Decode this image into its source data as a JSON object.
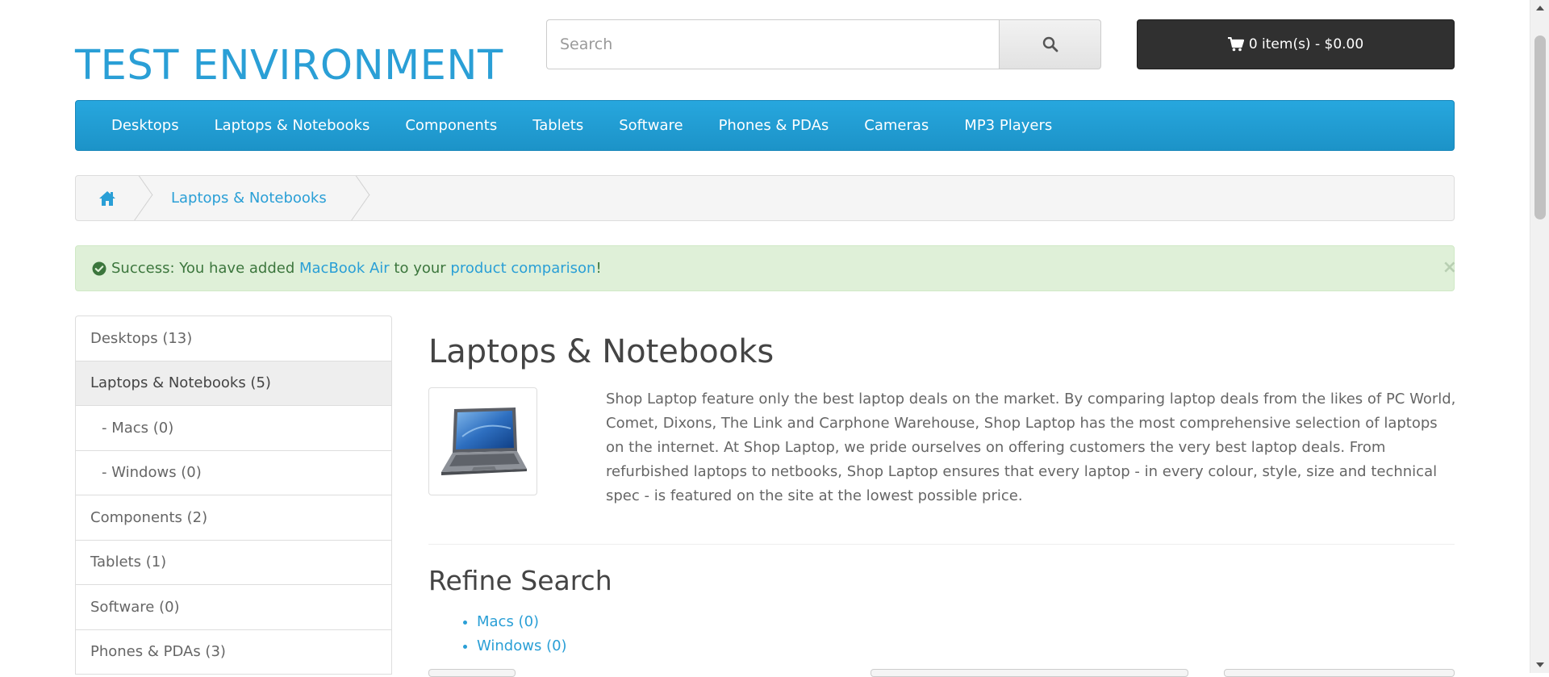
{
  "header": {
    "logo_text": "TEST ENVIRONMENT",
    "search": {
      "placeholder": "Search",
      "button_icon": "search-icon"
    },
    "cart": {
      "icon": "shopping-cart-icon",
      "label": "0 item(s) - $0.00"
    }
  },
  "menu": {
    "items": [
      {
        "label": "Desktops"
      },
      {
        "label": "Laptops & Notebooks"
      },
      {
        "label": "Components"
      },
      {
        "label": "Tablets"
      },
      {
        "label": "Software"
      },
      {
        "label": "Phones & PDAs"
      },
      {
        "label": "Cameras"
      },
      {
        "label": "MP3 Players"
      }
    ]
  },
  "breadcrumb": {
    "home_icon": "home-icon",
    "items": [
      {
        "label": "Laptops & Notebooks"
      }
    ]
  },
  "alert": {
    "icon": "check-circle-icon",
    "prefix": "Success: You have added ",
    "product_link": "MacBook Air",
    "middle": " to your ",
    "comparison_link": "product comparison",
    "suffix": "!",
    "close": "×",
    "colors": {
      "background": "#dff0d8",
      "text": "#3c763d",
      "link": "#2a9fd6"
    }
  },
  "sidebar": {
    "items": [
      {
        "label": "Desktops (13)",
        "active": false,
        "sub": false
      },
      {
        "label": "Laptops & Notebooks (5)",
        "active": true,
        "sub": false
      },
      {
        "label": "- Macs (0)",
        "active": false,
        "sub": true
      },
      {
        "label": "- Windows (0)",
        "active": false,
        "sub": true
      },
      {
        "label": "Components (2)",
        "active": false,
        "sub": false
      },
      {
        "label": "Tablets (1)",
        "active": false,
        "sub": false
      },
      {
        "label": "Software (0)",
        "active": false,
        "sub": false
      },
      {
        "label": "Phones & PDAs (3)",
        "active": false,
        "sub": false
      }
    ]
  },
  "content": {
    "title": "Laptops & Notebooks",
    "image_icon": "laptop-image",
    "description": "Shop Laptop feature only the best laptop deals on the market. By comparing laptop deals from the likes of PC World, Comet, Dixons, The Link and Carphone Warehouse, Shop Laptop has the most comprehensive selection of laptops on the internet. At Shop Laptop, we pride ourselves on offering customers the very best laptop deals. From refurbished laptops to netbooks, Shop Laptop ensures that every laptop - in every colour, style, size and technical spec - is featured on the site at the lowest possible price.",
    "refine_title": "Refine Search",
    "refine_items": [
      {
        "label": "Macs (0)"
      },
      {
        "label": "Windows (0)"
      }
    ]
  },
  "theme": {
    "accent": "#2a9fd6",
    "menu_bg": "#229ac8",
    "cart_bg": "#303030"
  }
}
